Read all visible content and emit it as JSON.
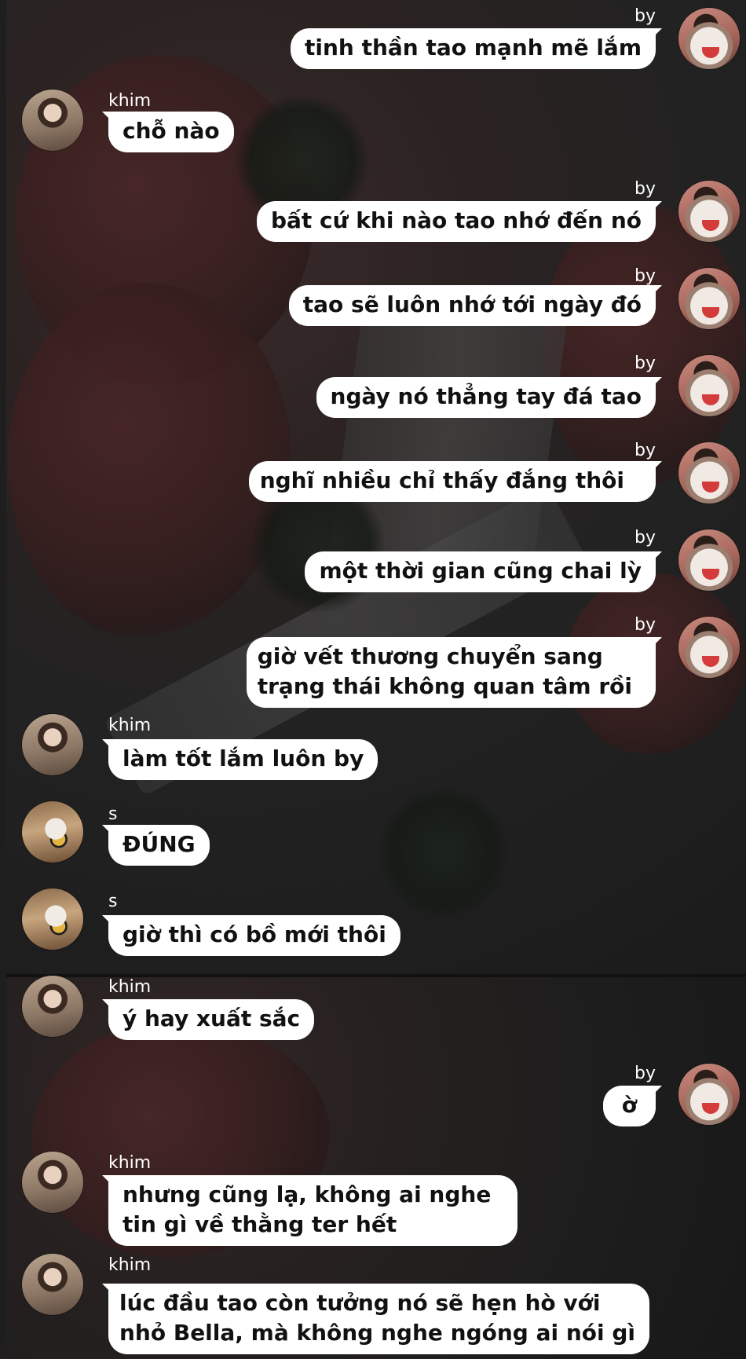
{
  "messages": [
    {
      "sender": "by",
      "text": "tinh thần tao mạnh mẽ lắm"
    },
    {
      "sender": "khim",
      "text": "chỗ nào"
    },
    {
      "sender": "by",
      "text": "bất cứ khi nào tao nhớ đến nó"
    },
    {
      "sender": "by",
      "text": "tao sẽ luôn nhớ tới ngày đó"
    },
    {
      "sender": "by",
      "text": "ngày nó thẳng tay đá tao"
    },
    {
      "sender": "by",
      "text": "nghĩ nhiều chỉ thấy đắng thôi"
    },
    {
      "sender": "by",
      "text": "một thời gian cũng chai lỳ"
    },
    {
      "sender": "by",
      "text": "giờ vết thương chuyển sang\ntrạng thái không quan tâm rồi"
    },
    {
      "sender": "khim",
      "text": "làm tốt lắm luôn by"
    },
    {
      "sender": "s",
      "text": "ĐÚNG"
    },
    {
      "sender": "s",
      "text": "giờ thì có bồ mới thôi"
    },
    {
      "sender": "khim",
      "text": "ý hay xuất sắc"
    },
    {
      "sender": "by",
      "text": "ờ"
    },
    {
      "sender": "khim",
      "text": "nhưng cũng lạ, không ai nghe\ntin gì về thằng ter hết"
    },
    {
      "sender": "khim",
      "text": "lúc đầu tao còn tưởng nó sẽ hẹn hò với\nnhỏ Bella, mà không nghe ngóng ai nói gì"
    }
  ]
}
